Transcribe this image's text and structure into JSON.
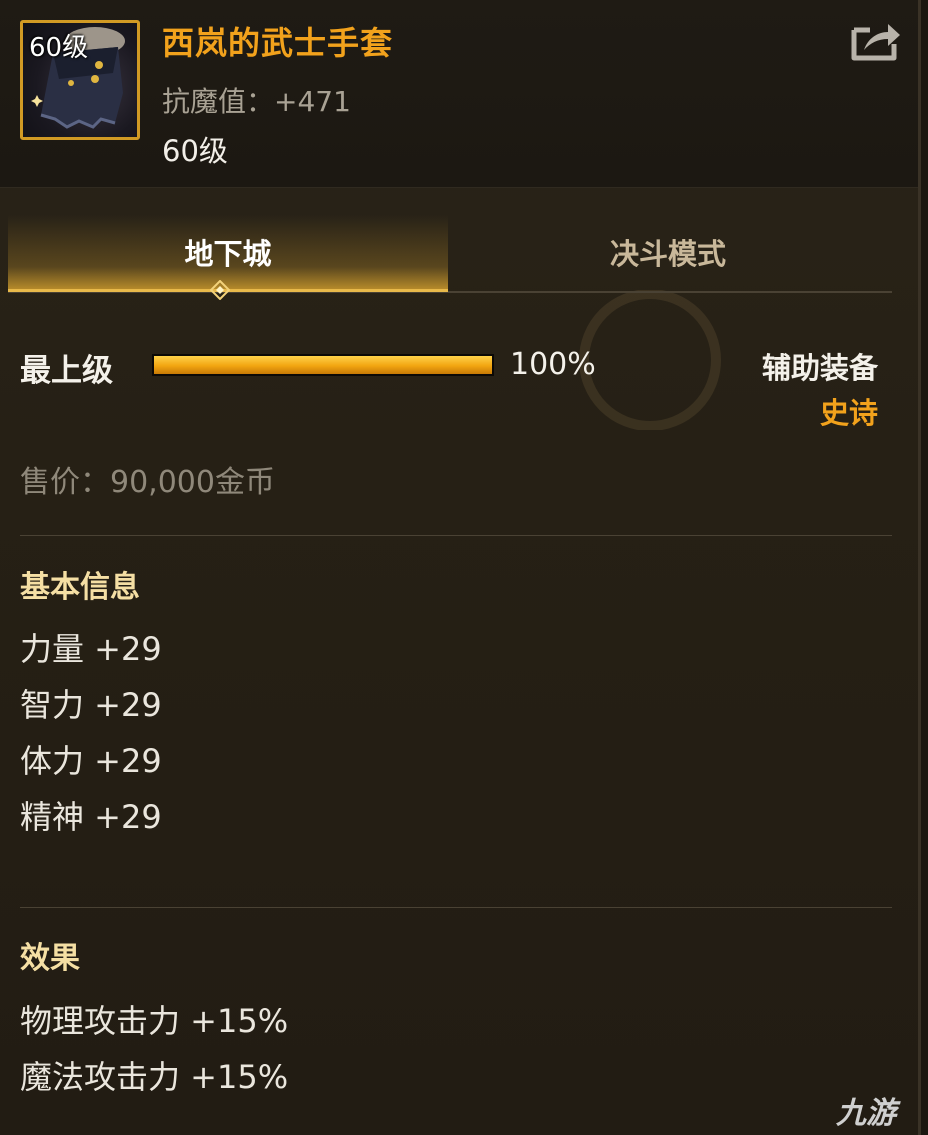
{
  "item": {
    "level_badge": "60级",
    "name": "西岚的武士手套",
    "resist_label": "抗魔值：",
    "resist_value": "+471",
    "required_level": "60级"
  },
  "tabs": [
    {
      "label": "地下城",
      "active": true
    },
    {
      "label": "决斗模式",
      "active": false
    }
  ],
  "grade": {
    "label": "最上级",
    "percent_text": "100%",
    "fill_fraction": 1.0
  },
  "equipment": {
    "type": "辅助装备",
    "rarity": "史诗"
  },
  "price": {
    "label": "售价：",
    "value": "90,000金币"
  },
  "basic_info": {
    "title": "基本信息",
    "stats": [
      "力量 +29",
      "智力 +29",
      "体力 +29",
      "精神 +29"
    ]
  },
  "effects": {
    "title": "效果",
    "lines": [
      "物理攻击力 +15%",
      "魔法攻击力 +15%"
    ]
  },
  "watermark": "九游",
  "colors": {
    "item_name": "#f2a21c",
    "rarity_epic": "#f2a21c",
    "section_title": "#f5dfa4",
    "frame_border": "#d19a24"
  },
  "icons": {
    "share": "share-icon",
    "tab_marker": "diamond-marker-icon"
  }
}
